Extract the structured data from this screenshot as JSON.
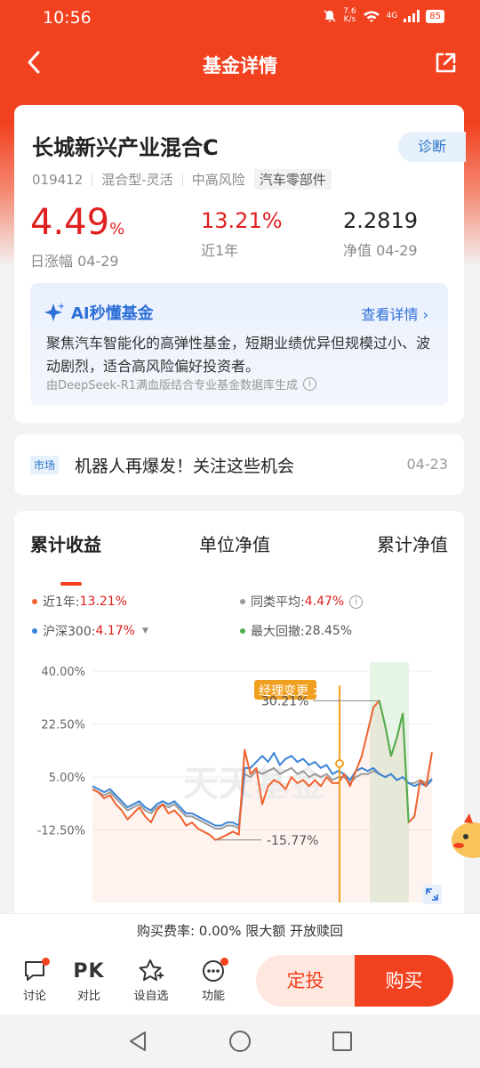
{
  "status": {
    "time": "10:56",
    "speed_top": "7.6",
    "speed_bottom": "K/s",
    "network": "4G",
    "battery": "85"
  },
  "nav": {
    "title": "基金详情"
  },
  "fund": {
    "name": "长城新兴产业混合C",
    "diagnose": "诊断",
    "code": "019412",
    "type": "混合型-灵活",
    "risk": "中高风险",
    "sector": "汽车零部件",
    "daily_change": "4.49",
    "daily_change_unit": "%",
    "daily_label": "日涨幅 04-29",
    "year_return": "13.21%",
    "year_label": "近1年",
    "nav_value": "2.2819",
    "nav_label": "净值 04-29"
  },
  "ai": {
    "title": "AI秒懂基金",
    "more": "查看详情",
    "body": "聚焦汽车智能化的高弹性基金，短期业绩优异但规模过小、波动剧烈，适合高风险偏好投资者。",
    "footer": "由DeepSeek-R1满血版结合专业基金数据库生成"
  },
  "news": {
    "tag": "市场",
    "title": "机器人再爆发！关注这些机会",
    "date": "04-23"
  },
  "chart_tabs": [
    "累计收益",
    "单位净值",
    "累计净值"
  ],
  "legend": {
    "fund_label": "近1年:",
    "fund_value": "13.21%",
    "peer_label": "同类平均:",
    "peer_value": "4.47%",
    "index_label": "沪深300:",
    "index_value": "4.17%",
    "drawdown_label": "最大回撤:",
    "drawdown_value": "28.45%"
  },
  "chart_annotations": {
    "manager_change": "经理变更 >",
    "peak": "30.21%",
    "trough": "-15.77%",
    "watermark": "天天基金"
  },
  "chart_data": {
    "type": "line",
    "yticks": [
      "40.00%",
      "22.50%",
      "5.00%",
      "-12.50%"
    ],
    "ylim": [
      -27,
      40
    ],
    "series": [
      {
        "name": "近1年",
        "color": "#f0622f",
        "values": [
          1,
          0,
          -2,
          -1,
          -4,
          -6,
          -9,
          -7,
          -5,
          -8,
          -10,
          -6,
          -4,
          -7,
          -6,
          -8,
          -11,
          -10,
          -12,
          -13,
          -14,
          -15.77,
          -15,
          -14,
          -13,
          -14,
          14,
          6,
          8,
          -4,
          2,
          4,
          3,
          1,
          5,
          3,
          4,
          2,
          4,
          2,
          5,
          3,
          3,
          6,
          2,
          7,
          12,
          20,
          28,
          30.21,
          22,
          12,
          18,
          26,
          -10,
          -8,
          4,
          2,
          13.21
        ]
      },
      {
        "name": "沪深300",
        "color": "#3b84d6",
        "values": [
          2,
          1,
          0,
          1,
          -1,
          -3,
          -5,
          -4,
          -3,
          -5,
          -6,
          -4,
          -3,
          -4,
          -3,
          -5,
          -7,
          -7,
          -8,
          -9,
          -10,
          -11,
          -11,
          -10,
          -10,
          -11,
          8,
          8,
          10,
          12,
          10,
          13,
          9,
          11,
          12,
          10,
          11,
          9,
          10,
          8,
          9,
          6,
          7,
          6,
          4,
          7,
          8,
          7,
          8,
          6,
          5,
          6,
          4,
          5,
          3,
          2,
          3,
          2,
          4.17
        ]
      },
      {
        "name": "同类平均",
        "color": "#9a9a9a",
        "values": [
          1,
          0,
          -1,
          0,
          -2,
          -4,
          -6,
          -5,
          -4,
          -6,
          -7,
          -5,
          -4,
          -5,
          -4,
          -6,
          -8,
          -8,
          -9,
          -10,
          -11,
          -12,
          -12,
          -11,
          -11,
          -12,
          6,
          5,
          7,
          6,
          7,
          8,
          6,
          7,
          8,
          6,
          7,
          5,
          6,
          5,
          6,
          4,
          5,
          5,
          3,
          5,
          6,
          6,
          7,
          6,
          5,
          6,
          4,
          5,
          3,
          3,
          4,
          3,
          4.47
        ]
      }
    ],
    "drawdown": "28.45%"
  },
  "fee": {
    "text": "购买费率: 0.00% 限大额 开放赎回"
  },
  "bottom": {
    "discuss": "讨论",
    "compare_icon": "PK",
    "compare": "对比",
    "watch": "设自选",
    "func": "功能",
    "invest": "定投",
    "buy": "购买"
  }
}
